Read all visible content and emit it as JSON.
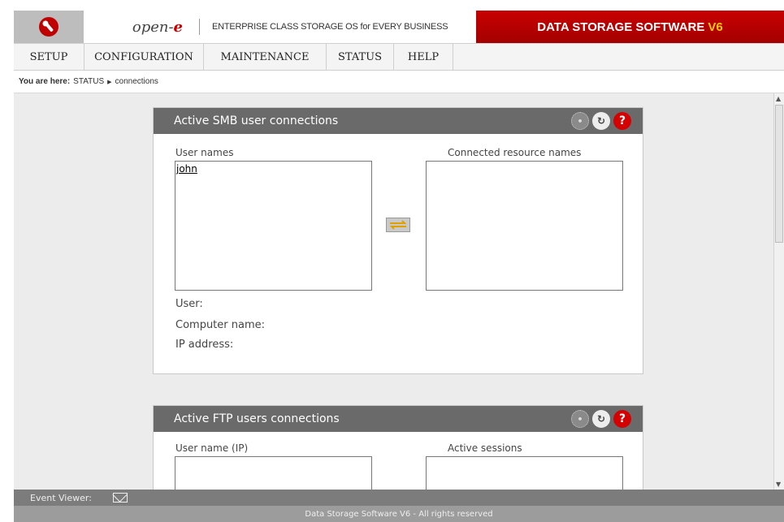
{
  "header": {
    "brand_open": "open-",
    "brand_e": "e",
    "tagline": "ENTERPRISE CLASS STORAGE OS for EVERY BUSINESS",
    "product": "DATA STORAGE SOFTWARE",
    "product_version": "V6"
  },
  "menu": [
    "SETUP",
    "CONFIGURATION",
    "MAINTENANCE",
    "STATUS",
    "HELP"
  ],
  "breadcrumb": {
    "prefix": "You are here:",
    "section": "STATUS",
    "page": "connections"
  },
  "smb_panel": {
    "title": "Active SMB user connections",
    "left_label": "User names",
    "right_label": "Connected resource names",
    "users": [
      "john"
    ],
    "fields": [
      "User:",
      "Computer name:",
      "IP address:"
    ]
  },
  "ftp_panel": {
    "title": "Active FTP users connections",
    "left_label": "User name (IP)",
    "right_label": "Active sessions"
  },
  "event_bar": {
    "label": "Event Viewer:"
  },
  "footer": {
    "text": "Data Storage Software V6 - All rights reserved"
  },
  "colors": {
    "brand_red": "#c00000",
    "version_yellow": "#ffcc00",
    "panel_header": "#6a6a6a"
  },
  "icons": [
    "wrench-icon",
    "loader-icon",
    "refresh-icon",
    "help-icon",
    "swap-arrows-icon",
    "mail-icon"
  ]
}
